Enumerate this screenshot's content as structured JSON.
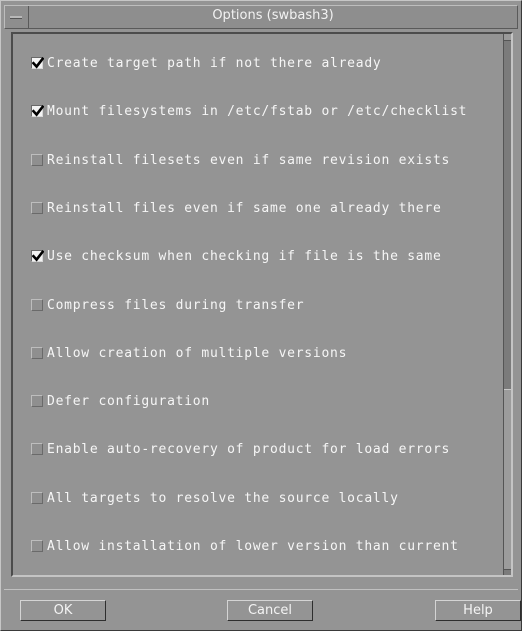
{
  "window": {
    "title": "Options (swbash3)"
  },
  "options": [
    {
      "label": "Create target path if not there already",
      "checked": true
    },
    {
      "label": "Mount filesystems in /etc/fstab or /etc/checklist",
      "checked": true
    },
    {
      "label": "Reinstall filesets even if same revision exists",
      "checked": false
    },
    {
      "label": "Reinstall files even if same one already there",
      "checked": false
    },
    {
      "label": "Use checksum when checking if file is the same",
      "checked": true
    },
    {
      "label": "Compress files during transfer",
      "checked": false
    },
    {
      "label": "Allow creation of multiple versions",
      "checked": false
    },
    {
      "label": "Defer configuration",
      "checked": false
    },
    {
      "label": "Enable auto-recovery of product for load errors",
      "checked": false
    },
    {
      "label": "All targets to resolve the source locally",
      "checked": false
    },
    {
      "label": "Allow installation of lower version than current",
      "checked": false
    }
  ],
  "buttons": {
    "ok": "OK",
    "cancel": "Cancel",
    "help": "Help"
  }
}
